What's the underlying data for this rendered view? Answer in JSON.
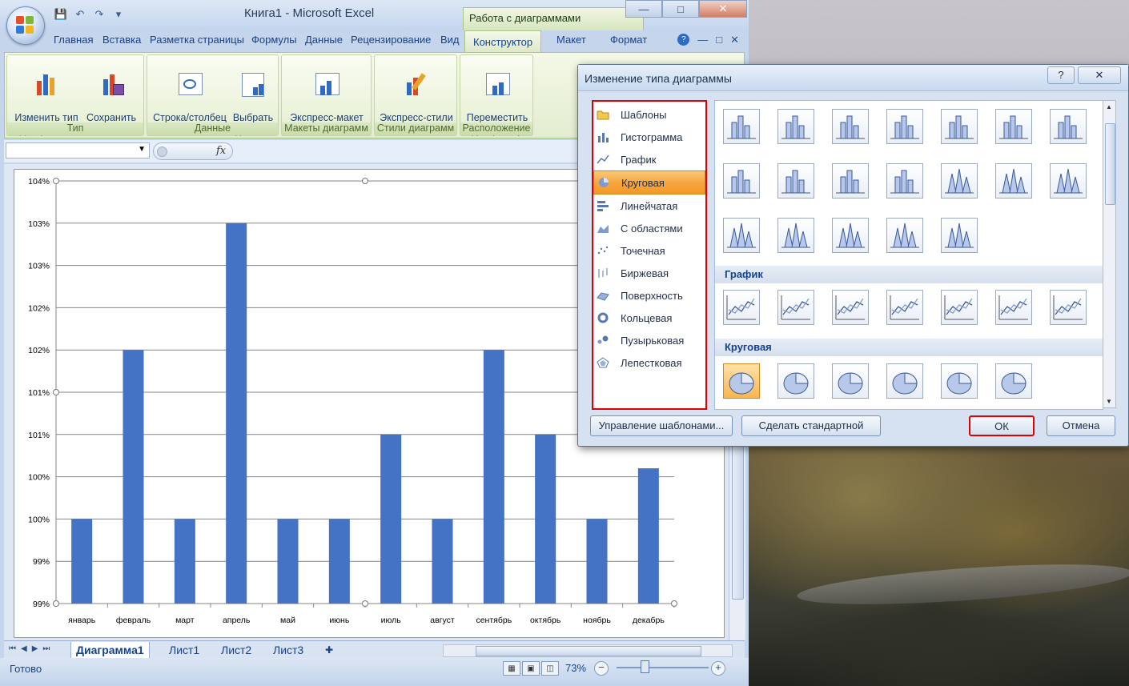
{
  "window": {
    "title": "Книга1 - Microsoft Excel",
    "context_title": "Работа с диаграммами",
    "controls": [
      "—",
      "□",
      "✕"
    ]
  },
  "qat": {
    "save": "💾",
    "undo": "↶",
    "redo": "↷",
    "more": "▾"
  },
  "ribbon_tabs": [
    {
      "label": "Главная"
    },
    {
      "label": "Вставка"
    },
    {
      "label": "Разметка страницы"
    },
    {
      "label": "Формулы"
    },
    {
      "label": "Данные"
    },
    {
      "label": "Рецензирование"
    },
    {
      "label": "Вид"
    },
    {
      "label": "Конструктор",
      "active": true
    },
    {
      "label": "Макет"
    },
    {
      "label": "Формат"
    }
  ],
  "ribbon": {
    "groups": [
      {
        "label": "Тип",
        "buttons": [
          "Изменить тип\nдиаграммы",
          "Сохранить\nкак шаблон"
        ]
      },
      {
        "label": "Данные",
        "buttons": [
          "Строка/столбец",
          "Выбрать\nданные"
        ]
      },
      {
        "label": "Макеты диаграмм",
        "buttons": [
          "Экспресс-макет\n▾"
        ]
      },
      {
        "label": "Стили диаграмм",
        "buttons": [
          "Экспресс-стили\n▾"
        ]
      },
      {
        "label": "Расположение",
        "buttons": [
          "Переместить\nдиаграмму"
        ]
      }
    ]
  },
  "formula_bar": {
    "fx": "fx",
    "namebox_value": "",
    "formula": ""
  },
  "chart_data": {
    "type": "bar",
    "categories": [
      "январь",
      "февраль",
      "март",
      "апрель",
      "май",
      "июнь",
      "июль",
      "август",
      "сентябрь",
      "октябрь",
      "ноябрь",
      "декабрь"
    ],
    "values": [
      100.0,
      102.0,
      100.0,
      103.5,
      100.0,
      100.0,
      101.0,
      100.0,
      102.0,
      101.0,
      100.0,
      100.6
    ],
    "ylim": [
      99.0,
      104.0
    ],
    "y_ticks": [
      99.0,
      99.5,
      100.0,
      100.5,
      101.0,
      101.5,
      102.0,
      102.5,
      103.0,
      103.5,
      104.0
    ],
    "y_tick_labels": [
      "99%",
      "99%",
      "100%",
      "100%",
      "101%",
      "101%",
      "102%",
      "102%",
      "103%",
      "103%",
      "104%"
    ],
    "title": "",
    "xlabel": "",
    "ylabel": "",
    "grid": true,
    "bar_color": "#4472c4"
  },
  "sheet_tabs": [
    "Диаграмма1",
    "Лист1",
    "Лист2",
    "Лист3"
  ],
  "status": {
    "text": "Готово",
    "zoom": "73%"
  },
  "dialog": {
    "title": "Изменение типа диаграммы",
    "help": "?",
    "close": "✕",
    "chart_types": [
      {
        "label": "Шаблоны",
        "icon": "folder-icon"
      },
      {
        "label": "Гистограмма",
        "icon": "column-chart-icon"
      },
      {
        "label": "График",
        "icon": "line-chart-icon"
      },
      {
        "label": "Круговая",
        "icon": "pie-chart-icon",
        "selected": true
      },
      {
        "label": "Линейчатая",
        "icon": "bar-chart-icon"
      },
      {
        "label": "С областями",
        "icon": "area-chart-icon"
      },
      {
        "label": "Точечная",
        "icon": "scatter-chart-icon"
      },
      {
        "label": "Биржевая",
        "icon": "stock-chart-icon"
      },
      {
        "label": "Поверхность",
        "icon": "surface-chart-icon"
      },
      {
        "label": "Кольцевая",
        "icon": "doughnut-chart-icon"
      },
      {
        "label": "Пузырьковая",
        "icon": "bubble-chart-icon"
      },
      {
        "label": "Лепестковая",
        "icon": "radar-chart-icon"
      }
    ],
    "sections": [
      "График",
      "Круговая"
    ],
    "buttons": {
      "manage_templates": "Управление шаблонами...",
      "set_default": "Сделать стандартной",
      "ok": "ОК",
      "cancel": "Отмена"
    },
    "accent_color": "#f7a640",
    "highlight_color": "#e00000"
  }
}
